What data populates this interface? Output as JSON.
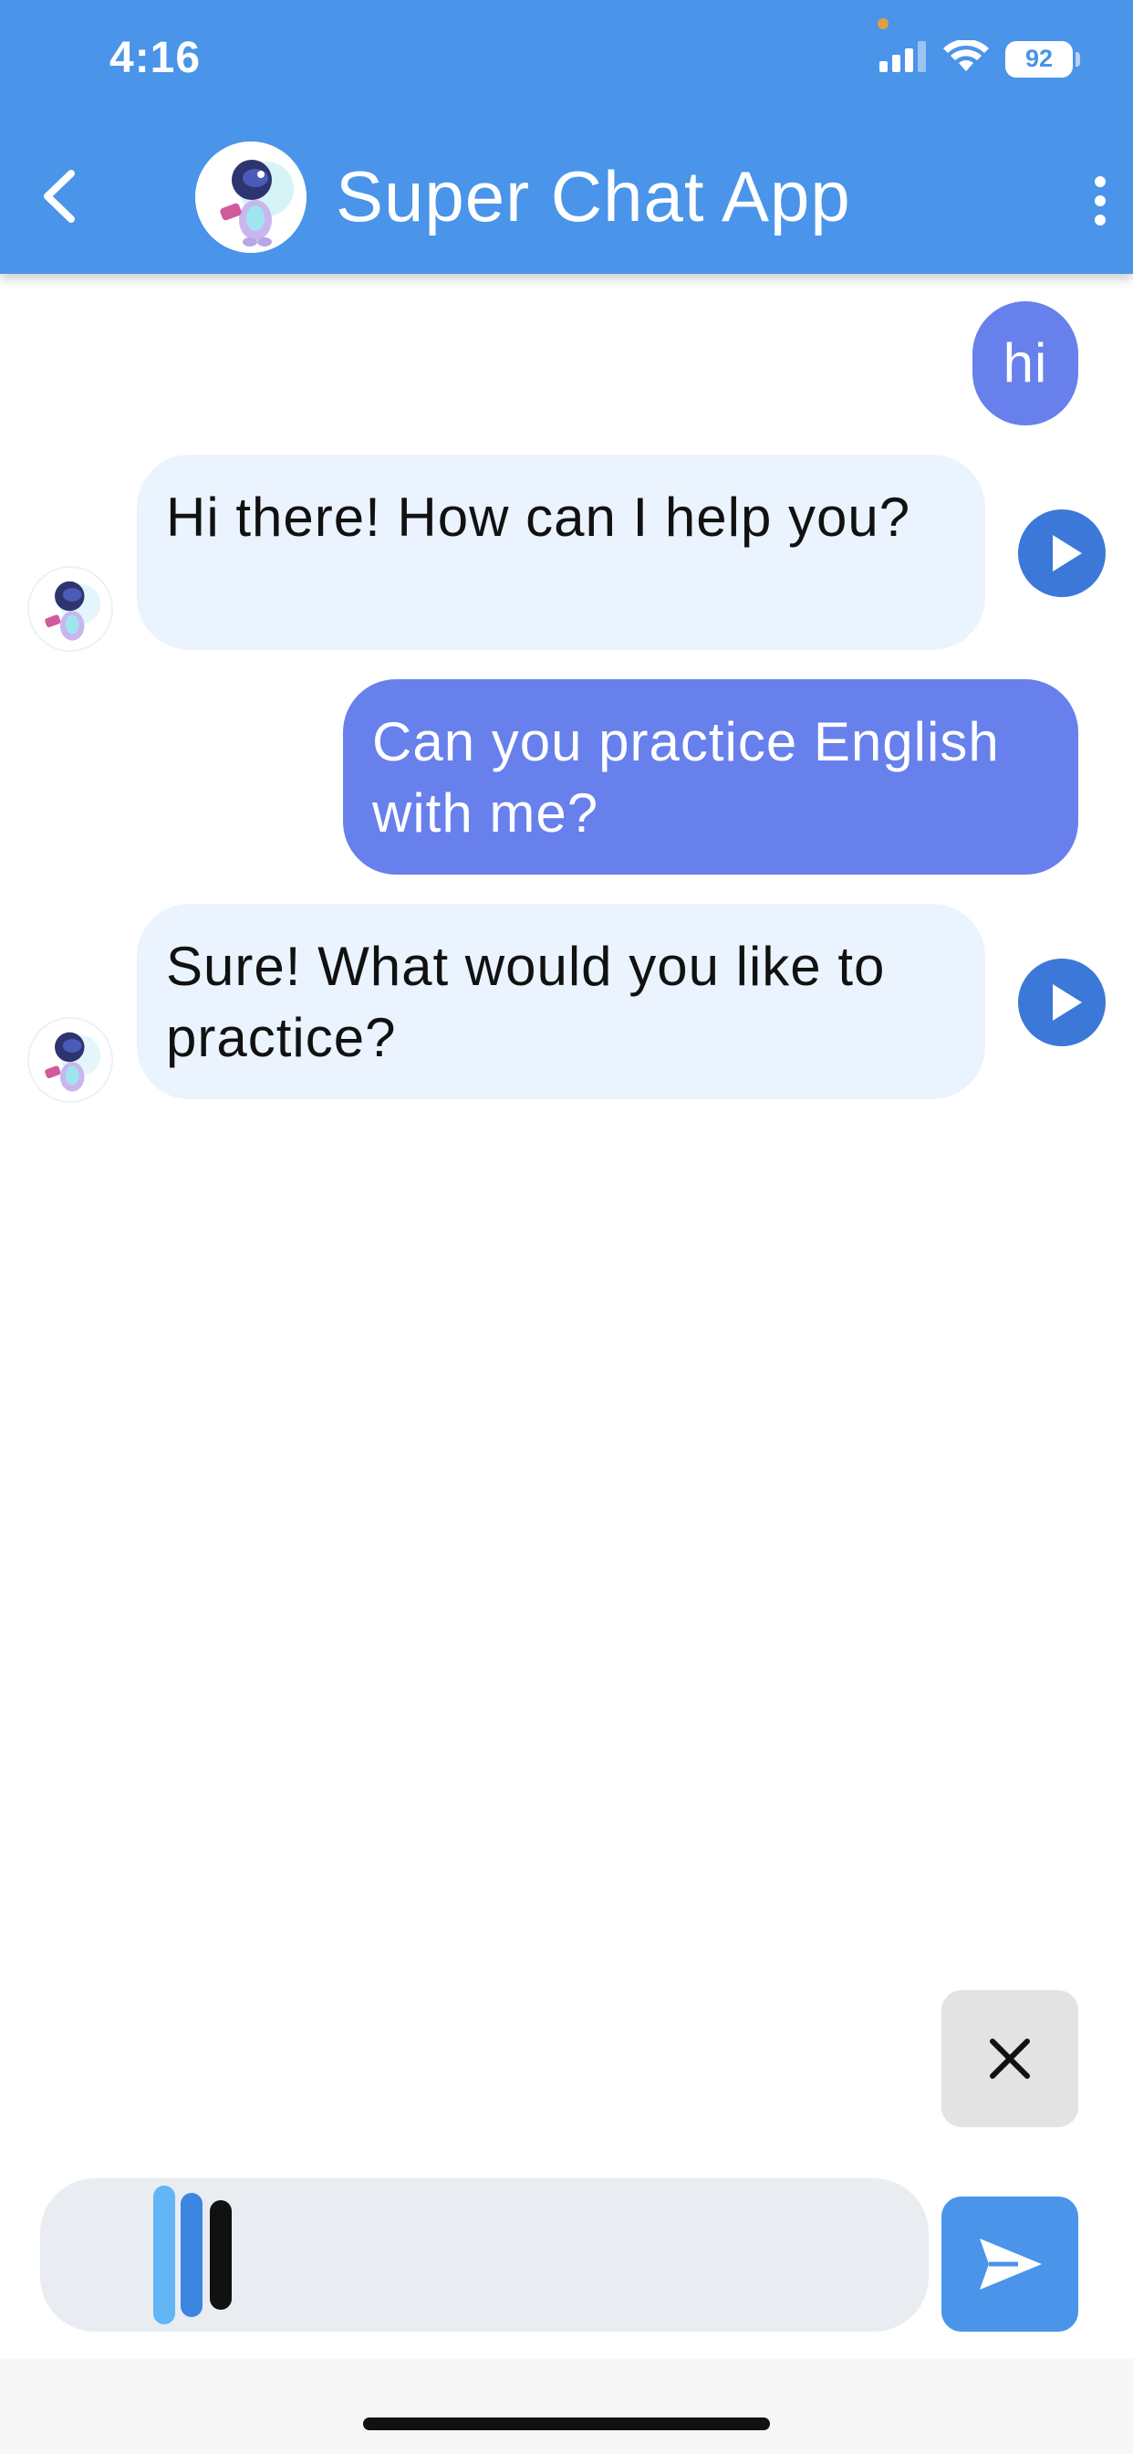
{
  "status_bar": {
    "time": "4:16",
    "battery": "92",
    "signal_icon": "cellular-signal-icon",
    "wifi_icon": "wifi-icon"
  },
  "header": {
    "title": "Super Chat App",
    "back_icon": "chevron-left-icon",
    "menu_icon": "more-vertical-icon",
    "background_color": "#4a94e9"
  },
  "messages": [
    {
      "role": "user",
      "text": "hi"
    },
    {
      "role": "bot",
      "text": "Hi there! How can I help you?"
    },
    {
      "role": "user",
      "text": "Can you practice English with me?"
    },
    {
      "role": "bot",
      "text": "Sure! What would you like to practice?"
    }
  ],
  "colors": {
    "user_bubble": "#6780ec",
    "bot_bubble": "#ebf3fe",
    "play_button": "#3b78d8",
    "send_button": "#4a94e9"
  },
  "controls": {
    "cancel_icon": "close-icon",
    "send_icon": "send-icon",
    "play_icon": "play-icon",
    "recording_indicator": "voice-waveform"
  }
}
